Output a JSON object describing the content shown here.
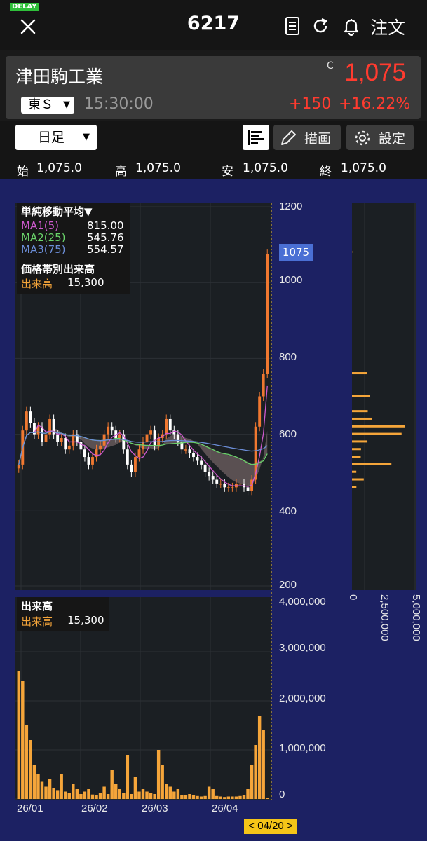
{
  "header": {
    "delay_badge": "DELAY",
    "close_icon": "close-icon",
    "code": "6217",
    "icons": [
      "document-icon",
      "refresh-icon",
      "bell-icon"
    ],
    "order_label": "注文"
  },
  "quote": {
    "name": "津田駒工業",
    "close_mark": "C",
    "price": "1,075",
    "market": "東Ｓ",
    "time": "15:30:00",
    "change": "+150",
    "change_pct": "+16.22%",
    "price_color": "#ff3b2f"
  },
  "controls": {
    "period": "日足",
    "draw_label": "描画",
    "settings_label": "設定"
  },
  "ohlc": {
    "open_label": "始",
    "open": "1,075.0",
    "high_label": "高",
    "high": "1,075.0",
    "low_label": "安",
    "low": "1,075.0",
    "close_label": "終",
    "close": "1,075.0"
  },
  "legend": {
    "sma_title": "単純移動平均▼",
    "ma1_label": "MA1(5)",
    "ma1_value": "815.00",
    "ma1_color": "#d05ad0",
    "ma2_label": "MA2(25)",
    "ma2_value": "545.76",
    "ma2_color": "#6ad36a",
    "ma3_label": "MA3(75)",
    "ma3_value": "554.57",
    "ma3_color": "#6c8ed8",
    "vbp_title": "価格帯別出来高",
    "vol_label": "出来高",
    "vol_value": "15,300"
  },
  "volume_legend": {
    "title": "出来高",
    "vol_label": "出来高",
    "vol_value": "15,300"
  },
  "price_axis": [
    "1200",
    "1000",
    "800",
    "600",
    "400",
    "200"
  ],
  "price_tag": "1075",
  "volume_axis": [
    "4,000,000",
    "3,000,000",
    "2,000,000",
    "1,000,000",
    "0"
  ],
  "vbp_axis": [
    "0",
    "2,500,000",
    "5,000,000"
  ],
  "date_axis": [
    "26/01",
    "26/02",
    "26/03",
    "26/04"
  ],
  "date_tag": "< 04/20 >",
  "chart_data": {
    "type": "candlestick",
    "price_ylim": [
      200,
      1200
    ],
    "volume_ylim": [
      0,
      4000000
    ],
    "close_values": [
      520,
      610,
      660,
      630,
      600,
      620,
      580,
      600,
      640,
      600,
      580,
      590,
      560,
      570,
      600,
      580,
      560,
      540,
      520,
      540,
      560,
      570,
      600,
      620,
      610,
      590,
      600,
      560,
      520,
      500,
      540,
      560,
      580,
      600,
      610,
      570,
      590,
      600,
      640,
      610,
      600,
      580,
      560,
      560,
      550,
      540,
      530,
      520,
      500,
      490,
      480,
      470,
      470,
      460,
      460,
      460,
      470,
      470,
      460,
      450,
      480,
      620,
      700,
      760,
      1075
    ],
    "volume_values": [
      2600000,
      2400000,
      1500000,
      1200000,
      700000,
      500000,
      350000,
      250000,
      400000,
      220000,
      180000,
      500000,
      150000,
      120000,
      300000,
      200000,
      100000,
      150000,
      200000,
      90000,
      80000,
      120000,
      250000,
      100000,
      600000,
      300000,
      200000,
      120000,
      900000,
      100000,
      450000,
      150000,
      200000,
      150000,
      120000,
      100000,
      1000000,
      700000,
      300000,
      250000,
      150000,
      200000,
      80000,
      80000,
      100000,
      80000,
      60000,
      50000,
      60000,
      250000,
      200000,
      60000,
      50000,
      40000,
      50000,
      50000,
      50000,
      60000,
      80000,
      200000,
      700000,
      1100000,
      1700000,
      1400000,
      15300
    ]
  }
}
